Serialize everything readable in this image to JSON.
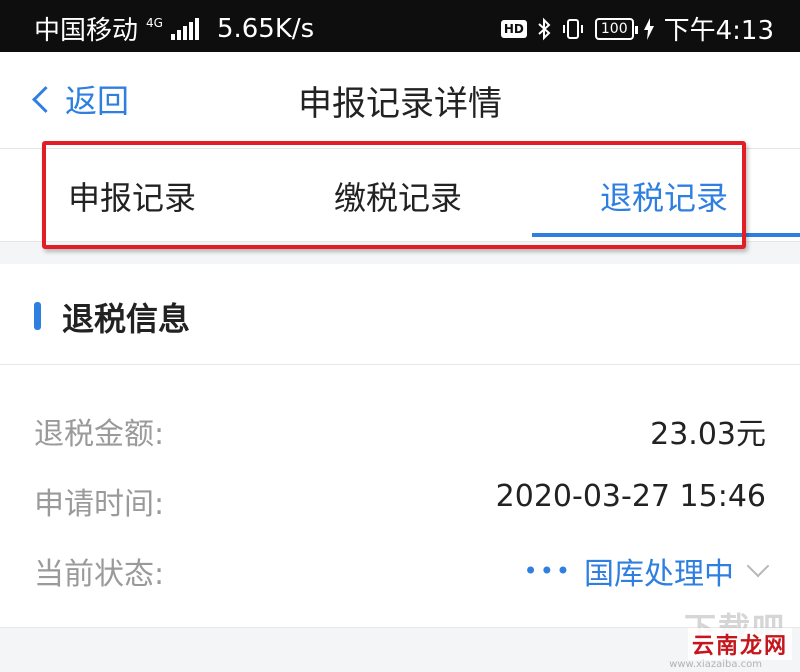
{
  "status_bar": {
    "carrier": "中国移动",
    "network": "4G",
    "speed": "5.65K/s",
    "hd": "HD",
    "battery": "100",
    "time": "下午4:13",
    "icons": [
      "signal-icon",
      "bluetooth-icon",
      "vibrate-icon",
      "battery-icon",
      "charging-icon"
    ]
  },
  "nav": {
    "back_label": "返回",
    "title": "申报记录详情"
  },
  "tabs": [
    {
      "label": "申报记录",
      "active": false
    },
    {
      "label": "缴税记录",
      "active": false
    },
    {
      "label": "退税记录",
      "active": true
    }
  ],
  "section": {
    "title": "退税信息"
  },
  "details": [
    {
      "label": "退税金额:",
      "value": "23.03元"
    },
    {
      "label": "申请时间:",
      "value": "2020-03-27 15:46"
    },
    {
      "label": "当前状态:",
      "value": "国库处理中"
    }
  ],
  "watermark": {
    "top": "下载吧",
    "bottom": "云南龙网",
    "sub": "www.xiazaiba.com"
  },
  "colors": {
    "accent": "#2f7fe0",
    "highlight": "#e21d26",
    "label": "#9a9a9a"
  }
}
